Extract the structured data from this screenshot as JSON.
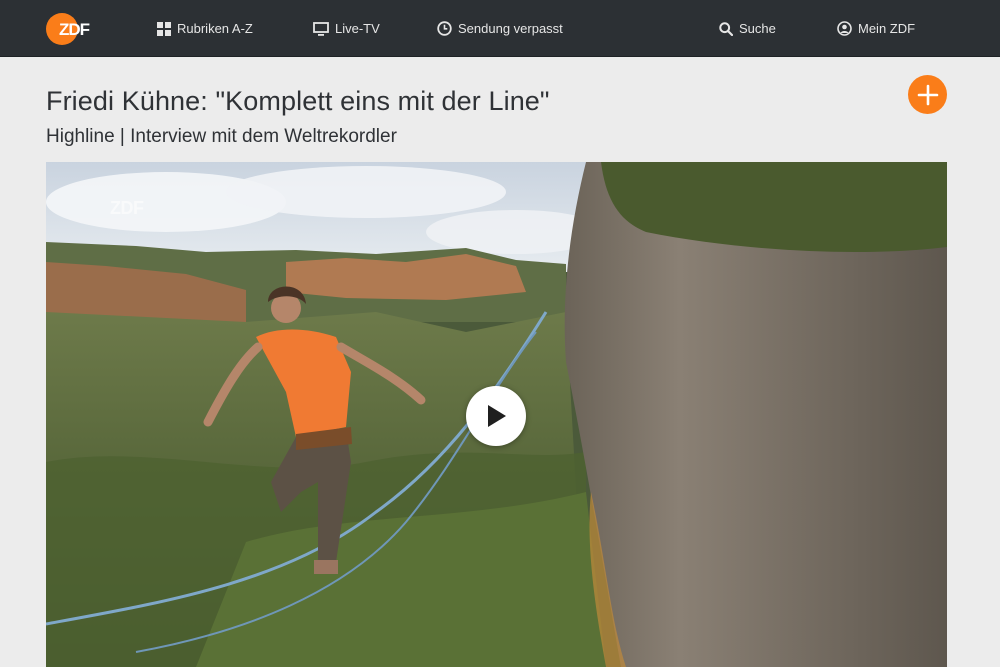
{
  "brand": {
    "logo_text": "ZDF",
    "accent_color": "#fa7d19",
    "nav_bg": "#2c3034"
  },
  "nav": {
    "rubriken": {
      "label": "Rubriken A-Z",
      "icon": "grid-icon"
    },
    "live": {
      "label": "Live-TV",
      "icon": "tv-icon"
    },
    "verpasst": {
      "label": "Sendung verpasst",
      "icon": "clock-icon"
    },
    "suche": {
      "label": "Suche",
      "icon": "search-icon"
    },
    "mein_zdf": {
      "label": "Mein ZDF",
      "icon": "user-icon"
    }
  },
  "page": {
    "title": "Friedi Kühne: \"Komplett eins mit der Line\"",
    "subtitle": "Highline | Interview mit dem Weltrekordler",
    "add_icon": "plus-icon"
  },
  "player": {
    "watermark": "ZDF",
    "play_icon": "play-icon"
  }
}
